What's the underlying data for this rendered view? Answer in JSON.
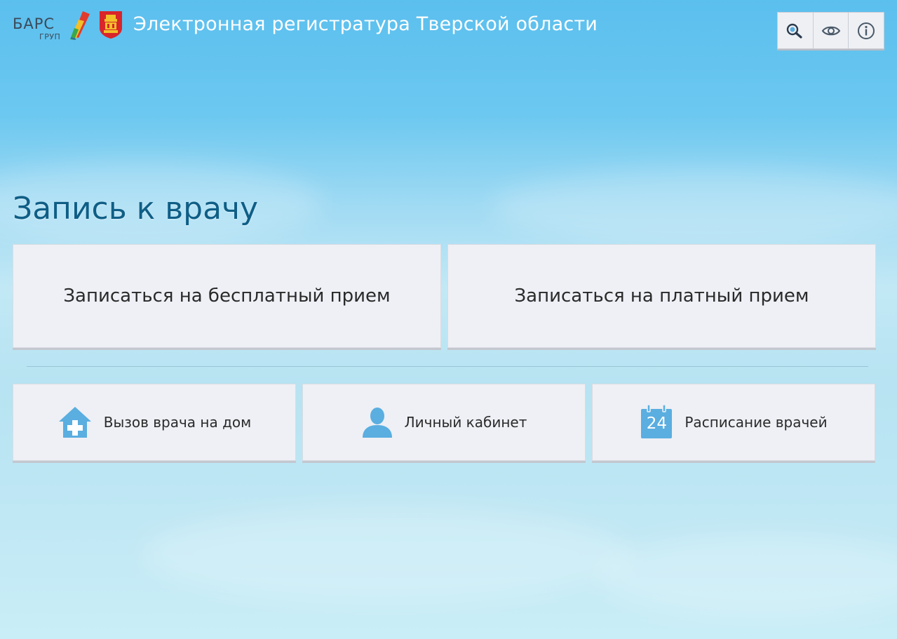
{
  "header": {
    "logo_text": "БАРС",
    "logo_subtext": "ГРУП",
    "title": "Электронная регистратура Тверской области",
    "tools": [
      {
        "icon": "zoom-search-icon"
      },
      {
        "icon": "eye-icon"
      },
      {
        "icon": "info-icon"
      }
    ]
  },
  "main": {
    "section_title": "Запись к врачу",
    "primary_actions": [
      {
        "label": "Записаться на бесплатный прием"
      },
      {
        "label": "Записаться на платный прием"
      }
    ],
    "secondary_actions": [
      {
        "label": "Вызов врача на дом",
        "icon": "house-plus-icon"
      },
      {
        "label": "Личный кабинет",
        "icon": "user-icon"
      },
      {
        "label": "Расписание врачей",
        "icon": "calendar-icon",
        "icon_text": "24"
      }
    ]
  },
  "colors": {
    "title": "#0f5e86",
    "icon_accent": "#5aaee0",
    "tile_bg": "#eef0f5"
  }
}
